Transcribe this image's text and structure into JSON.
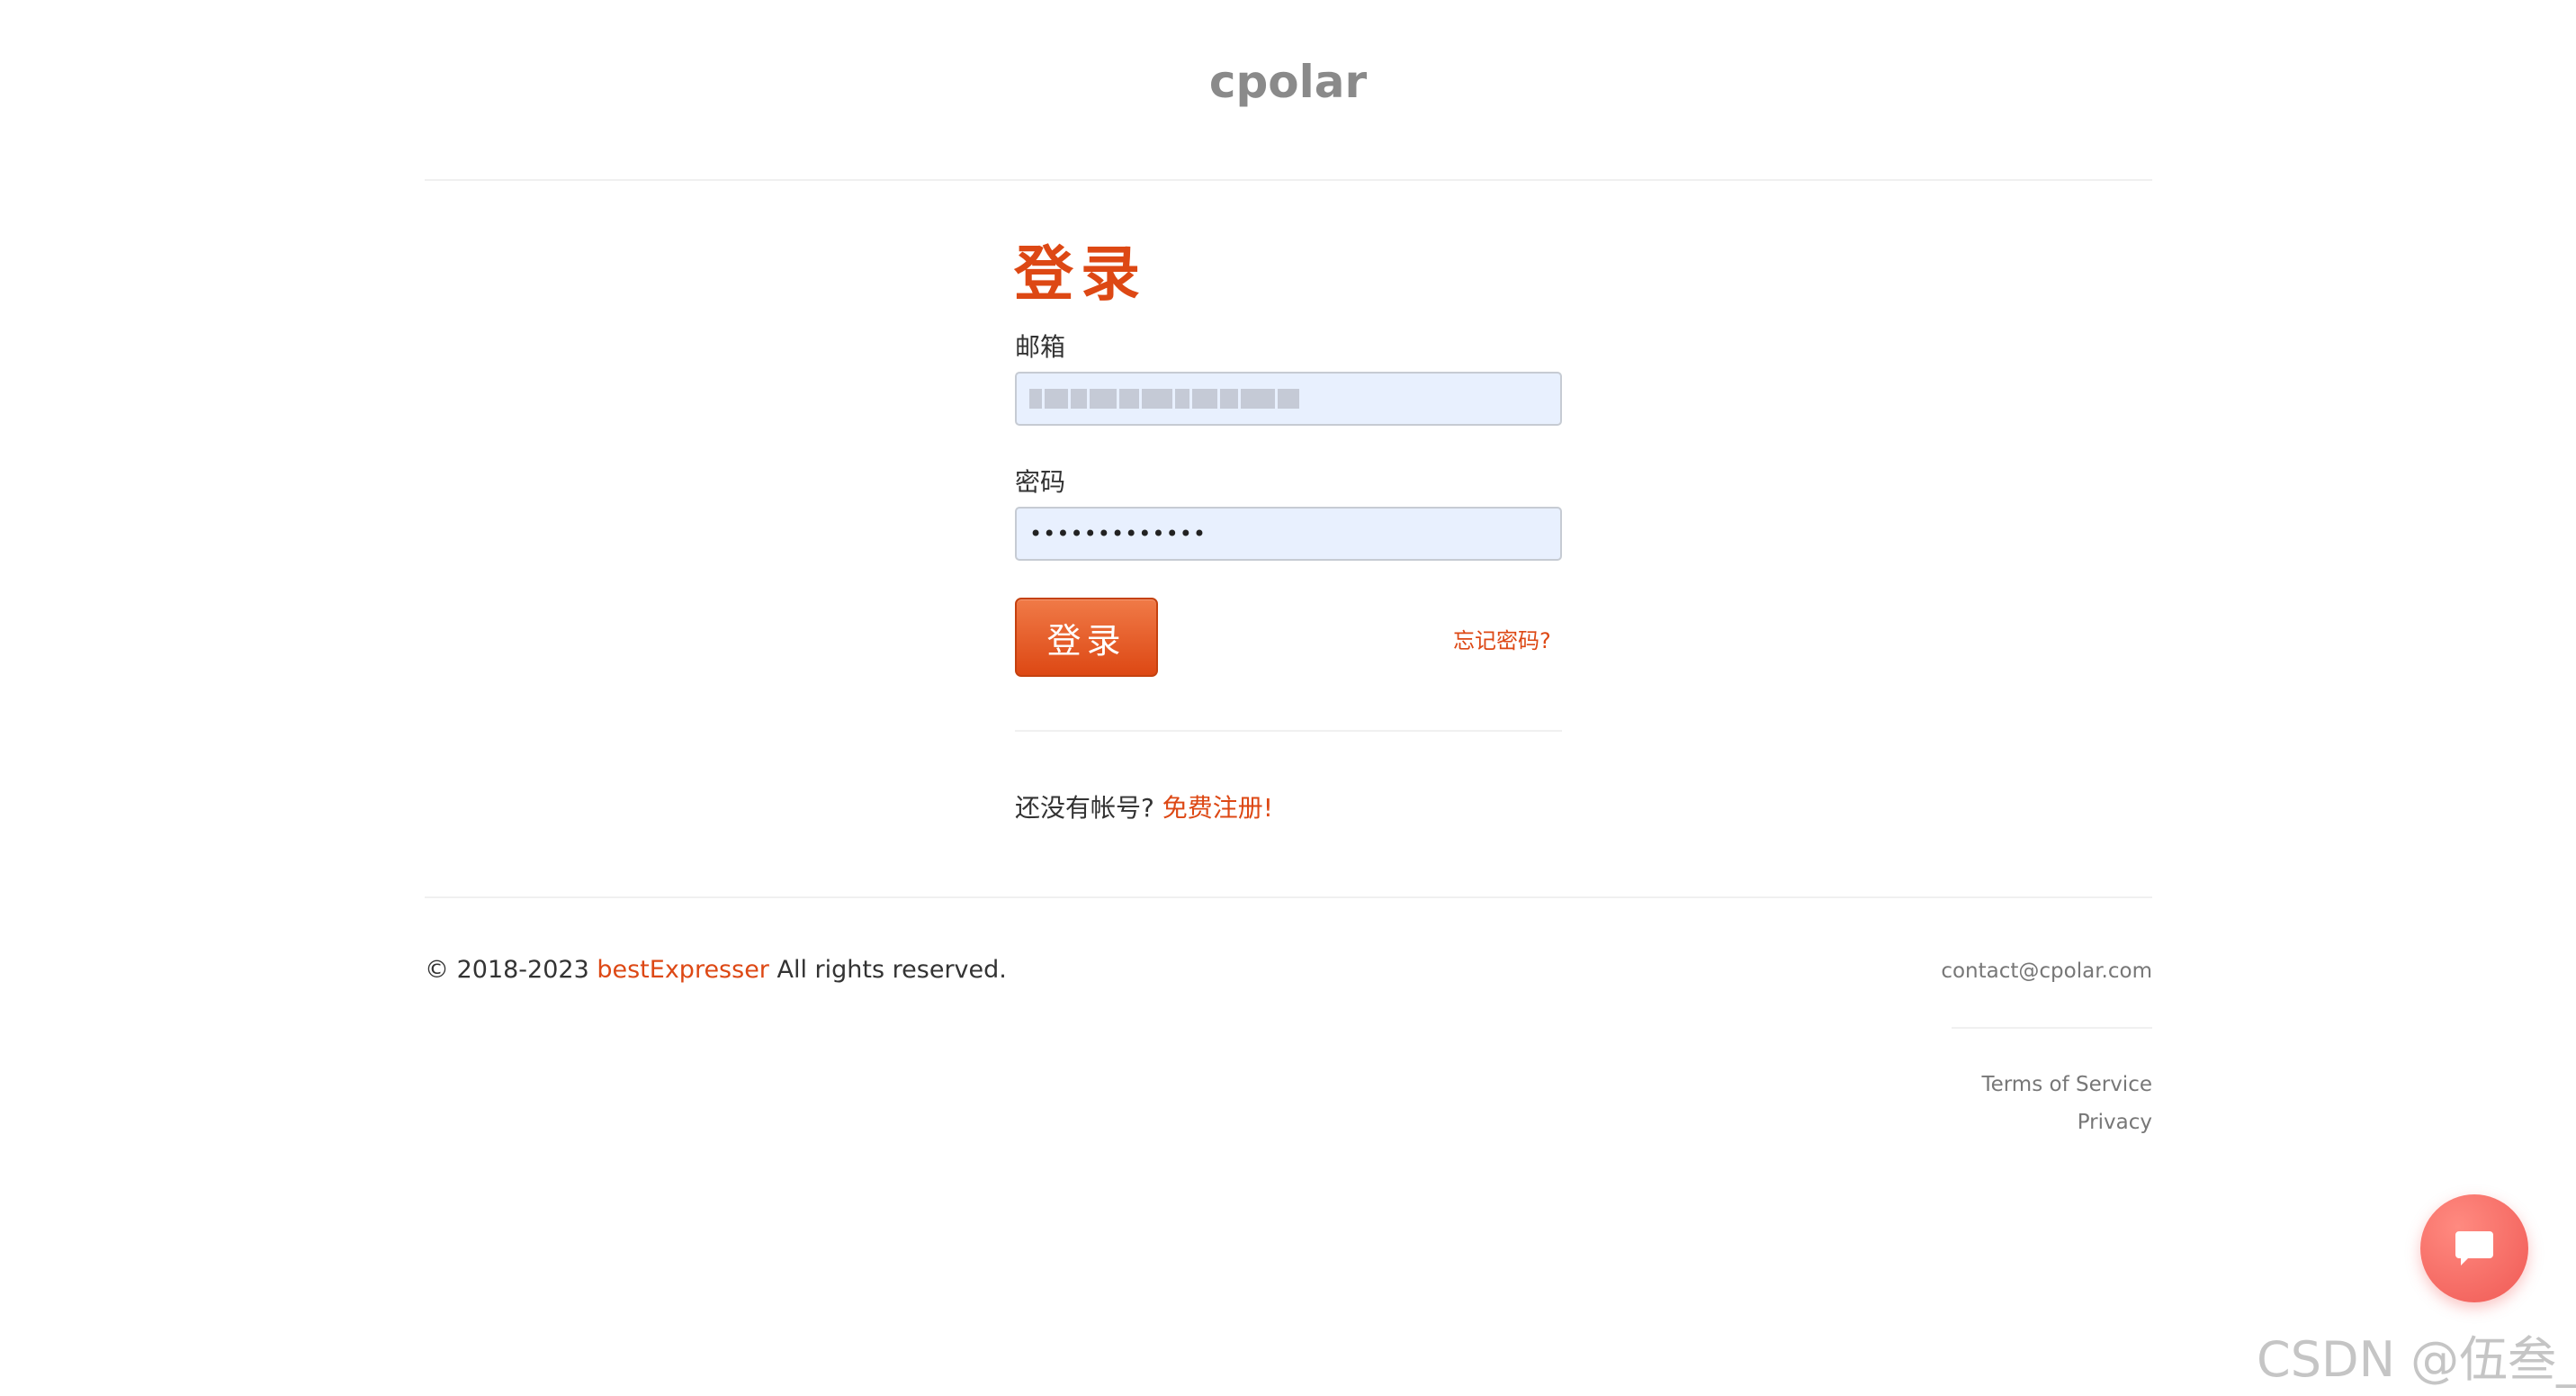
{
  "header": {
    "brand": "cpolar"
  },
  "login": {
    "title": "登录",
    "email_label": "邮箱",
    "password_label": "密码",
    "password_value": "•••••••••••••",
    "submit_label": "登录",
    "forgot_label": "忘记密码?"
  },
  "signup": {
    "prompt": "还没有帐号?",
    "link_label": "免费注册!"
  },
  "footer": {
    "copyright_prefix": "© 2018-2023",
    "company": "bestExpresser",
    "copyright_suffix": "All rights reserved.",
    "contact": "contact@cpolar.com",
    "terms": "Terms of Service",
    "privacy": "Privacy"
  },
  "icons": {
    "chat": "chat-icon"
  },
  "colors": {
    "accent": "#dd4814",
    "input_bg": "#e8f0fe",
    "chat_bg": "#f05a55"
  },
  "watermark": "CSDN @伍叁_"
}
